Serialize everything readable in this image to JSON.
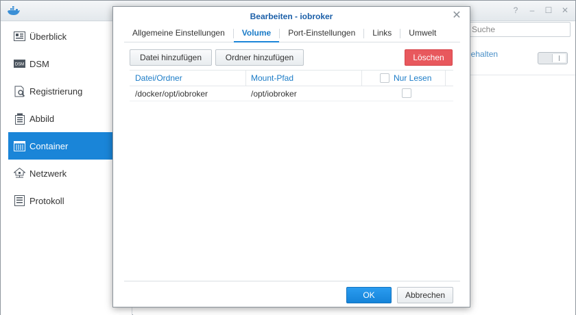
{
  "app": {
    "window_controls": [
      "?",
      "–",
      "☐",
      "✕"
    ],
    "sidebar": {
      "items": [
        {
          "label": "Überblick",
          "icon": "overview-icon",
          "active": false
        },
        {
          "label": "DSM",
          "icon": "dsm-icon",
          "active": false
        },
        {
          "label": "Registrierung",
          "icon": "registry-icon",
          "active": false
        },
        {
          "label": "Abbild",
          "icon": "image-icon",
          "active": false
        },
        {
          "label": "Container",
          "icon": "container-icon",
          "active": true
        },
        {
          "label": "Netzwerk",
          "icon": "network-icon",
          "active": false
        },
        {
          "label": "Protokoll",
          "icon": "log-icon",
          "active": false
        }
      ]
    },
    "search": {
      "placeholder": "Suche"
    },
    "status_text": "gehalten",
    "colors": {
      "accent": "#1a85d8",
      "danger": "#e8585d",
      "title": "#1b5fa8"
    }
  },
  "dialog": {
    "title": "Bearbeiten - iobroker",
    "tabs": [
      {
        "label": "Allgemeine Einstellungen",
        "active": false
      },
      {
        "label": "Volume",
        "active": true
      },
      {
        "label": "Port-Einstellungen",
        "active": false
      },
      {
        "label": "Links",
        "active": false
      },
      {
        "label": "Umwelt",
        "active": false
      }
    ],
    "toolbar": {
      "add_file_label": "Datei hinzufügen",
      "add_folder_label": "Ordner hinzufügen",
      "delete_label": "Löschen"
    },
    "grid": {
      "headers": {
        "file_folder": "Datei/Ordner",
        "mount_path": "Mount-Pfad",
        "read_only": "Nur Lesen"
      },
      "rows": [
        {
          "file_folder": "/docker/opt/iobroker",
          "mount_path": "/opt/iobroker",
          "read_only": false
        }
      ]
    },
    "footer": {
      "ok_label": "OK",
      "cancel_label": "Abbrechen"
    }
  }
}
